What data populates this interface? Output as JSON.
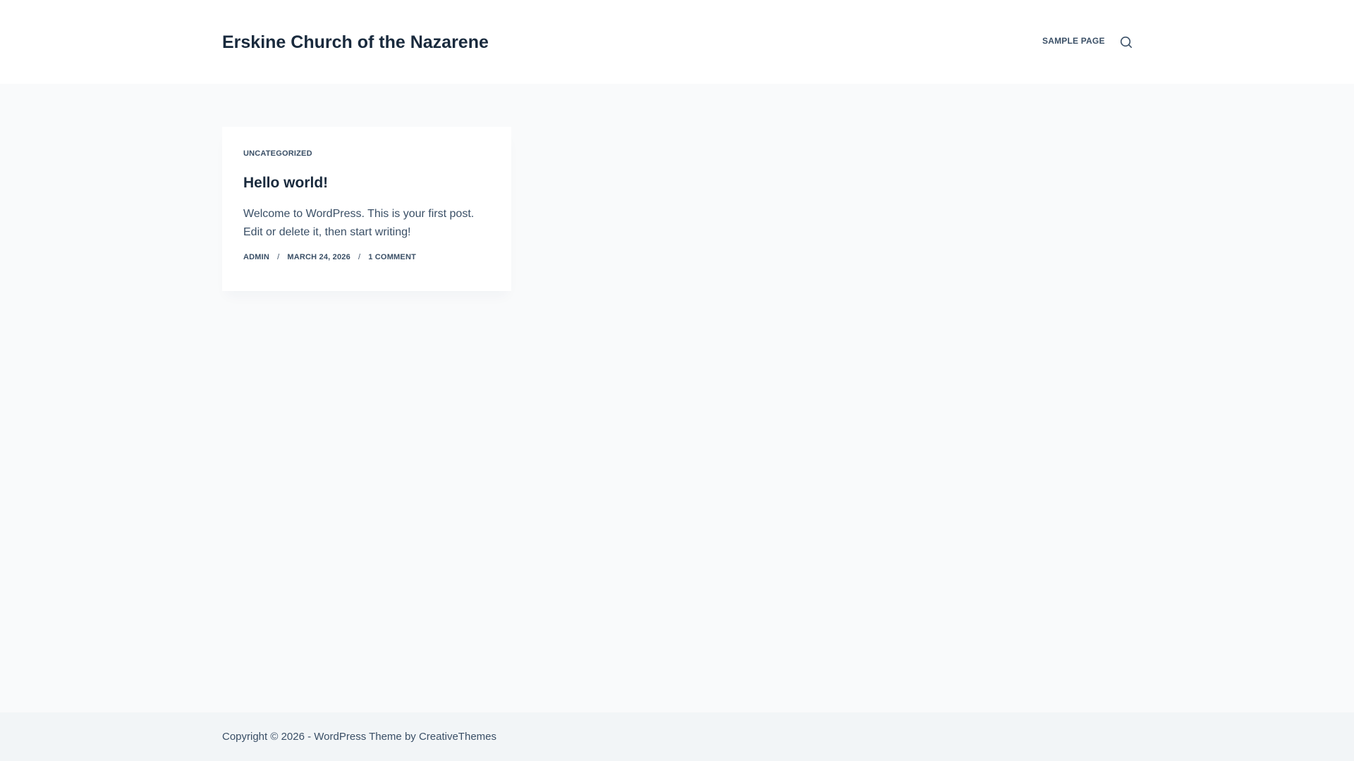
{
  "header": {
    "site_title": "Erskine Church of the Nazarene",
    "nav": [
      {
        "label": "SAMPLE PAGE"
      }
    ],
    "search_icon": "search-icon"
  },
  "post": {
    "category": "UNCATEGORIZED",
    "title": "Hello world!",
    "excerpt": "Welcome to WordPress. This is your first post. Edit or delete it, then start writing!",
    "meta": {
      "author": "ADMIN",
      "date": "MARCH 24, 2026",
      "comments": "1 COMMENT",
      "separator": "/"
    }
  },
  "footer": {
    "copyright_prefix": "Copyright © 2026 - WordPress Theme by ",
    "theme_author_link": "CreativeThemes"
  },
  "colors": {
    "heading": "#192a3d",
    "text": "#3a4f66",
    "background": "#f9fafb",
    "footer_background": "#f2f5f7"
  }
}
